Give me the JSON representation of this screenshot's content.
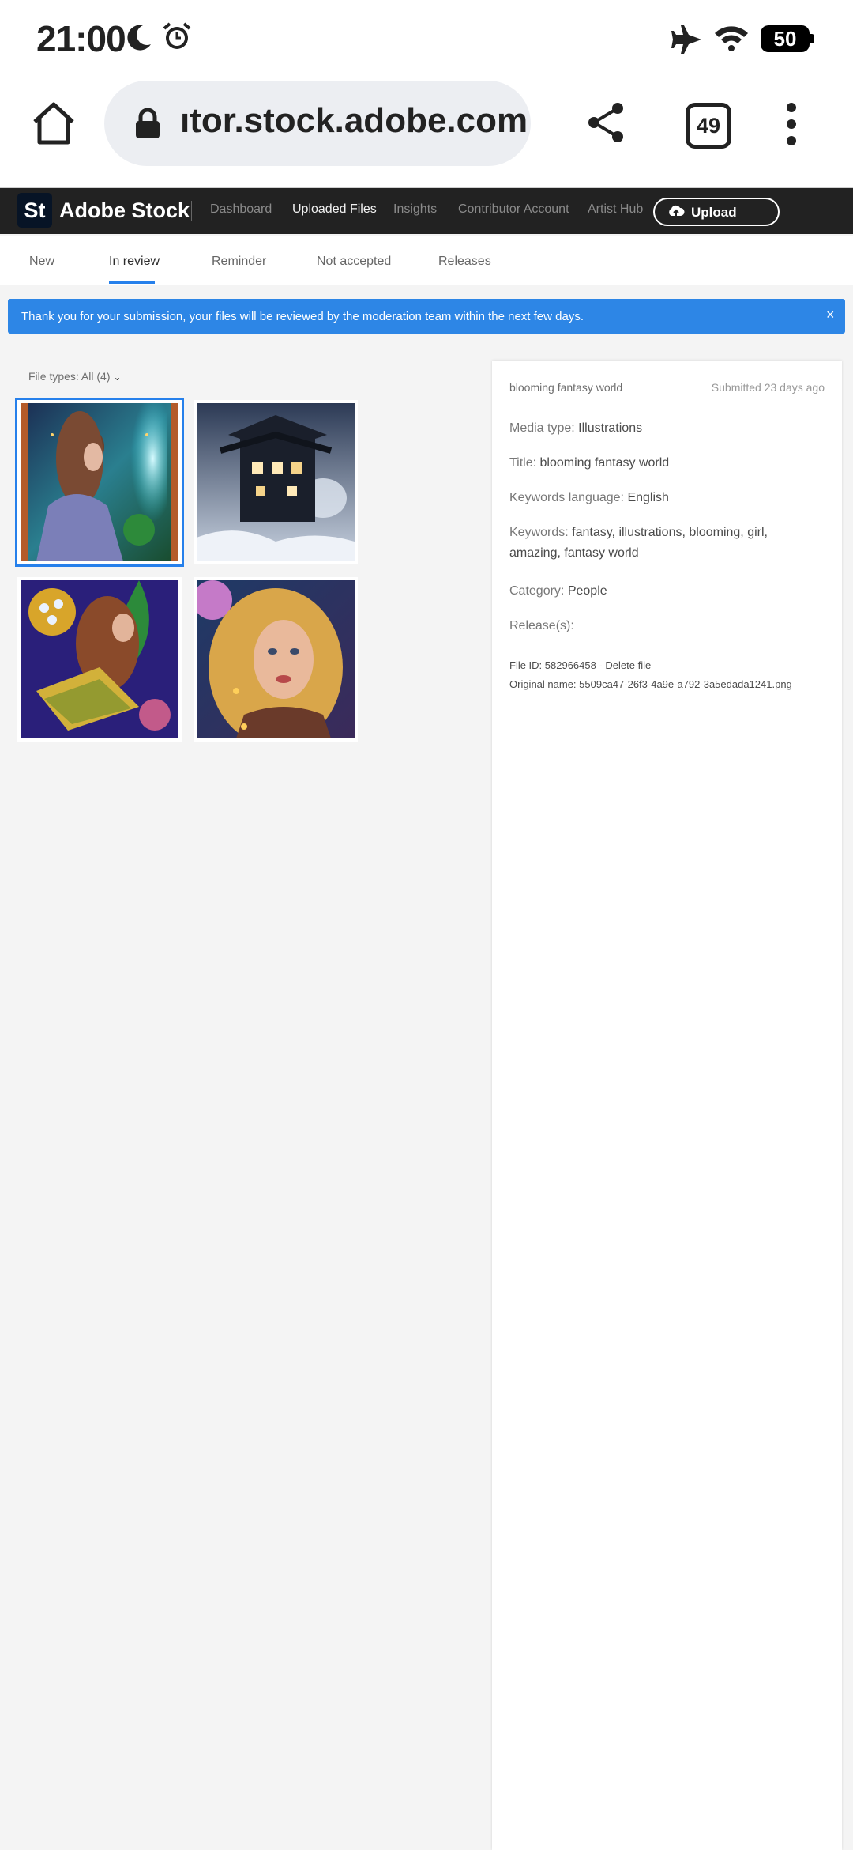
{
  "status_bar": {
    "time": "21:00",
    "battery": "50"
  },
  "browser": {
    "url": "ıtor.stock.adobe.com",
    "tab_count": "49"
  },
  "header": {
    "logo": "St",
    "brand": "Adobe Stock",
    "nav": [
      "Dashboard",
      "Uploaded Files",
      "Insights",
      "Contributor Account",
      "Artist Hub"
    ],
    "active_nav": "Uploaded Files",
    "upload_label": "Upload"
  },
  "tabs": [
    "New",
    "In review",
    "Reminder",
    "Not accepted",
    "Releases"
  ],
  "active_tab": "In review",
  "banner": {
    "text": "Thank you for your submission, your files will be reviewed by the moderation team within the next few days.",
    "close": "×"
  },
  "filter": {
    "label": "File types: All (4)"
  },
  "details": {
    "title": "blooming fantasy world",
    "submitted": "Submitted 23 days ago",
    "media_type_label": "Media type:",
    "media_type": "Illustrations",
    "title_label": "Title:",
    "title_value": "blooming fantasy world",
    "language_label": "Keywords language:",
    "language": "English",
    "keywords_label": "Keywords:",
    "keywords_line1": "fantasy, illustrations, blooming, girl,",
    "keywords_line2": "amazing, fantasy world",
    "category_label": "Category:",
    "category": "People",
    "releases_label": "Release(s):",
    "file_id": "File ID: 582966458 - Delete file",
    "original_name": "Original name: 5509ca47-26f3-4a9e-a792-3a5edada1241.png"
  },
  "colors": {
    "accent": "#2680eb",
    "banner": "#2d86e6",
    "header_bg": "#222222"
  }
}
